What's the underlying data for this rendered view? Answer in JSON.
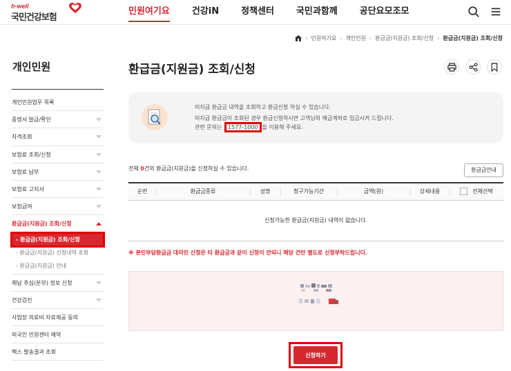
{
  "logo": {
    "sub": "h-well",
    "main": "국민건강보험"
  },
  "nav": [
    "민원여기요",
    "건강iN",
    "정책센터",
    "국민과함께",
    "공단요모조모"
  ],
  "header_icons": [
    "search-icon",
    "menu-icon"
  ],
  "breadcrumb": {
    "items": [
      "민원여기요",
      "개인민원",
      "환급금(지원금) 조회/신청"
    ],
    "current": "환급금(지원금) 조회/신청"
  },
  "sidebar": {
    "title": "개인민원",
    "items": [
      {
        "label": "개인민원업무 목록",
        "chevron": false
      },
      {
        "label": "증명서 발급/확인",
        "chevron": true
      },
      {
        "label": "자격조회",
        "chevron": true
      },
      {
        "label": "보험료 조회/신청",
        "chevron": true
      },
      {
        "label": "보험료 납부",
        "chevron": true
      },
      {
        "label": "보험료 고지서",
        "chevron": true
      },
      {
        "label": "보험급여",
        "chevron": true
      }
    ],
    "open_item": {
      "label": "환급금(지원금) 조회/신청"
    },
    "sub_items": [
      "- 환급금(지원금) 조회/신청",
      "- 환급금(지원금) 신청내역 조회",
      "- 환급금(지원금) 안내"
    ],
    "items_after": [
      {
        "label": "체납 추심(분부) 정보 신청",
        "chevron": true
      },
      {
        "label": "건강검진",
        "chevron": true
      },
      {
        "label": "사업장 의료비 자료제공 동의",
        "chevron": false
      },
      {
        "label": "외국인 민원센터 예약",
        "chevron": false
      },
      {
        "label": "팩스 발송결과 조회",
        "chevron": false
      }
    ]
  },
  "page": {
    "title": "환급금(지원금) 조회/신청",
    "actions": [
      "print-icon",
      "share-icon",
      "bookmark-icon"
    ]
  },
  "info": {
    "line1": "미지급 환급금 내역을 조회하고 환급신청 하실 수 있습니다.",
    "line2": "미지급 환급금이 조회된 경우 환급신청하시면 고객님의 예금계좌로 입금시켜 드립니다.",
    "line3_prefix": "관련 문의는",
    "phone": "1577-1000",
    "line3_suffix": "을 이용해 주세요."
  },
  "count": {
    "prefix": "전체",
    "value": "0",
    "suffix": "건의 환급금(지원금)을 신청하실 수 있습니다."
  },
  "guide_button": "환급금안내",
  "table": {
    "headers": [
      "순번",
      "환급금종류",
      "성명",
      "청구가능기간",
      "금액(원)",
      "상세내용",
      "전체선택"
    ],
    "empty": "신청가능한 환급금(지원금) 내역이 없습니다."
  },
  "notice": "※ 본인부담환급금 대리인 신청은 타 환급금과 같이 신청이 안되니 해당 건만 별도로 신청부탁드립니다.",
  "apply_button": "신청하기",
  "colors": {
    "accent": "#d8282f",
    "highlight": "#e10000",
    "info_bg": "#f4f4f4",
    "pink_bg": "#fcf0f0"
  }
}
